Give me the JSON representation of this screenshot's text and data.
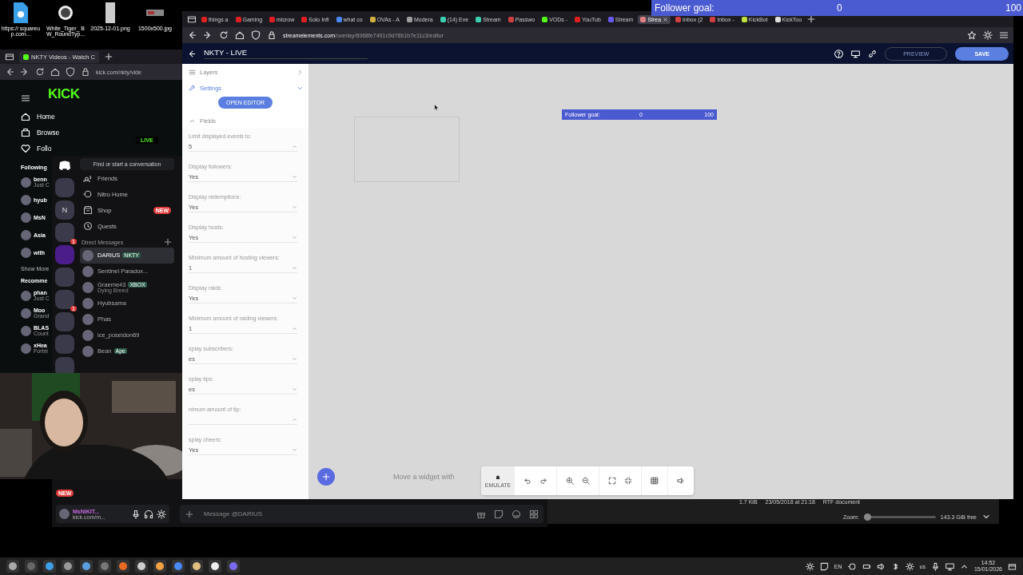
{
  "desktop_icons": [
    {
      "label": "https:// squareup.com...",
      "kind": "web"
    },
    {
      "label": "White_Tiger_ BW_RoundTyp...",
      "kind": "round"
    },
    {
      "label": "2025-12-01.png",
      "kind": "doc"
    },
    {
      "label": "1500x500.jpg",
      "kind": "banner"
    }
  ],
  "follower_goal_overlay": {
    "label": "Follower goal:",
    "current": "0",
    "target": "100"
  },
  "kick_window": {
    "tab": "NKTY Videos - Watch C",
    "url": "kick.com/nkty/vide",
    "logo": "KICK",
    "live_badge": "LIVE",
    "nav": [
      {
        "label": "Home",
        "kind": "home"
      },
      {
        "label": "Browse",
        "kind": "browse"
      },
      {
        "label": "Follo",
        "kind": "heart"
      }
    ],
    "following_heading": "Following",
    "following": [
      {
        "name": "benn",
        "status": "Just C"
      },
      {
        "name": "hyub"
      },
      {
        "name": "MsN"
      },
      {
        "name": "Asia"
      },
      {
        "name": "with"
      }
    ],
    "show_more": "Show More",
    "recommended_heading": "Recomme",
    "recommended": [
      {
        "name": "phan",
        "status": "Just C"
      },
      {
        "name": "Moo",
        "status": "Grand"
      },
      {
        "name": "BLAS",
        "status": "Count"
      },
      {
        "name": "xHea",
        "status": "Fortni"
      }
    ]
  },
  "discord": {
    "search": "Find or start a conversation",
    "servers": [
      {
        "kind": "avatar"
      },
      {
        "kind": "letter",
        "label": "N"
      },
      {
        "kind": "avatar",
        "badge": "1"
      },
      {
        "kind": "folder"
      },
      {
        "kind": "avatar"
      },
      {
        "kind": "avatar",
        "badge": "1"
      },
      {
        "kind": "avatar"
      },
      {
        "kind": "avatar"
      },
      {
        "kind": "avatar"
      }
    ],
    "nav": [
      {
        "label": "Friends",
        "kind": "friends"
      },
      {
        "label": "Nitro Home",
        "kind": "nitro"
      },
      {
        "label": "Shop",
        "kind": "shop",
        "badge": "NEW"
      },
      {
        "label": "Quests",
        "kind": "quests"
      }
    ],
    "dm_heading": "Direct Messages",
    "dms": [
      {
        "name": "DARIUS",
        "tag": "NKTY",
        "selected": true
      },
      {
        "name": "Sentinel Paradox...",
        "selected": false
      },
      {
        "name": "Graeme43",
        "tag": "XBOX",
        "activity": "Dying Breed",
        "selected": false
      },
      {
        "name": "Hyubsama",
        "selected": false
      },
      {
        "name": "Phas",
        "selected": false
      },
      {
        "name": "ice_poseidon69",
        "selected": false
      },
      {
        "name": "Bean",
        "tag": "Ape",
        "selected": false
      }
    ],
    "new_badge": "NEW",
    "user": {
      "name": "MsNIKIT...",
      "status": "kick.com/m..."
    },
    "message_placeholder": "Message @DARIUS"
  },
  "editor_browser": {
    "tabs": [
      {
        "label": "things a",
        "color": "#e02020",
        "selected": false
      },
      {
        "label": "Gaming",
        "color": "#e02020",
        "selected": false
      },
      {
        "label": "microw",
        "color": "#e02020",
        "selected": false
      },
      {
        "label": "Solo Infi",
        "color": "#e02020",
        "selected": false
      },
      {
        "label": "what co",
        "color": "#4a8af4",
        "selected": false
      },
      {
        "label": "OVAs - A",
        "color": "#d0b040",
        "selected": false
      },
      {
        "label": "Modera",
        "color": "#a0a0a0",
        "selected": false
      },
      {
        "label": "(14) Eve",
        "color": "#3ccfb0",
        "selected": false
      },
      {
        "label": "Stream",
        "color": "#3ccfb0",
        "selected": false
      },
      {
        "label": "Passwo",
        "color": "#d04040",
        "selected": false
      },
      {
        "label": "VODs -",
        "color": "#53fc18",
        "selected": false
      },
      {
        "label": "YouTub",
        "color": "#e02020",
        "selected": false
      },
      {
        "label": "Stream",
        "color": "#6a5af0",
        "selected": false
      },
      {
        "label": "Strea",
        "color": "#e08080",
        "selected": true
      },
      {
        "label": "Inbox (2",
        "color": "#d04040",
        "selected": false
      },
      {
        "label": "Inbox -",
        "color": "#d04040",
        "selected": false
      },
      {
        "label": "KickBot",
        "color": "#c0e040",
        "selected": false
      },
      {
        "label": "KickToo",
        "color": "#e0e0e0",
        "selected": false
      }
    ],
    "url_domain": "streamelements.com",
    "url_path": "/overlay/6968fe7491c9d78b1b7e11c3/editor",
    "title": "NKTY - LIVE",
    "preview": "PREVIEW",
    "save": "SAVE",
    "panel": {
      "layers": "Layers",
      "settings": "Settings",
      "open_editor": "OPEN EDITOR",
      "fields_heading": "Fields",
      "fields": [
        {
          "label": "Limit displayed events to:",
          "value": "5",
          "kind": "number"
        },
        {
          "label": "Display followers:",
          "value": "Yes",
          "kind": "select"
        },
        {
          "label": "Display redemptions:",
          "value": "Yes",
          "kind": "select"
        },
        {
          "label": "Display hosts:",
          "value": "Yes",
          "kind": "select"
        },
        {
          "label": "Minimum amount of hosting viewers:",
          "value": "1",
          "kind": "number"
        },
        {
          "label": "Display raids:",
          "value": "Yes",
          "kind": "select"
        },
        {
          "label": "Minimum amount of raiding viewers:",
          "value": "1",
          "kind": "number"
        },
        {
          "label": "splay subscribers:",
          "value": "es",
          "kind": "select"
        },
        {
          "label": "splay tips:",
          "value": "es",
          "kind": "select"
        },
        {
          "label": "nimum amount of tip:",
          "kind": "number"
        },
        {
          "label": "splay cheers:",
          "value": "Yes",
          "kind": "select"
        }
      ]
    },
    "follower_goal": {
      "label": "Follower goal:",
      "current": "0",
      "target": "100"
    },
    "hint": "Move a widget with",
    "emulate": "EMULATE"
  },
  "file_manager": {
    "size": "1.7 KiB",
    "date": "23/05/2018 at 21:18",
    "type": "RTF document",
    "zoom_label": "Zoom:",
    "zoom_slider": {
      "level": 0.05
    },
    "free_space": "143.3 GiB free"
  },
  "taskbar": {
    "language": "EN",
    "layout": "us",
    "time": "14:52",
    "date": "15/01/2026"
  }
}
